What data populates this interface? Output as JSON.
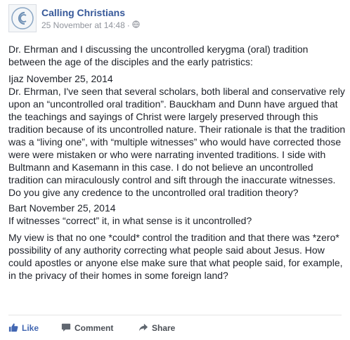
{
  "post": {
    "page_name": "Calling Christians",
    "timestamp": "25 November at 14:48",
    "separator": "·",
    "intro": "Dr. Ehrman and I discussing the uncontrolled kerygma (oral) tradition between the age of the disciples and the early patristics:",
    "ijaz_header": "Ijaz November 25, 2014",
    "ijaz_text": "Dr. Ehrman, I've seen that several scholars, both liberal and conservative rely upon an “uncontrolled oral tradition”. Bauckham and Dunn have argued that the teachings and sayings of Christ were largely preserved through this tradition because of its uncontrolled nature. Their rationale is that the tradition was a “living one”, with “multiple witnesses” who would have corrected those were were mistaken or who were narrating invented traditions. I side with Bultmann and Kasemann in this case. I do not believe an uncontrolled tradition can miraculously control and sift through the inaccurate witnesses. Do you give any credence to the uncontrolled oral tradition theory?",
    "bart_header": "Bart November 25, 2014",
    "bart_question": "If witnesses “correct” it, in what sense is it uncontrolled?",
    "bart_answer": "My view is that no one *could* control the tradition and that there was *zero* possibility of any authority correcting what people said about Jesus. How could apostles or anyone else make sure that what people said, for example, in the privacy of their homes in some foreign land?"
  },
  "actions": {
    "like": "Like",
    "comment": "Comment",
    "share": "Share"
  },
  "colors": {
    "link": "#365899",
    "like_blue": "#4267b2",
    "muted": "#90949c"
  }
}
